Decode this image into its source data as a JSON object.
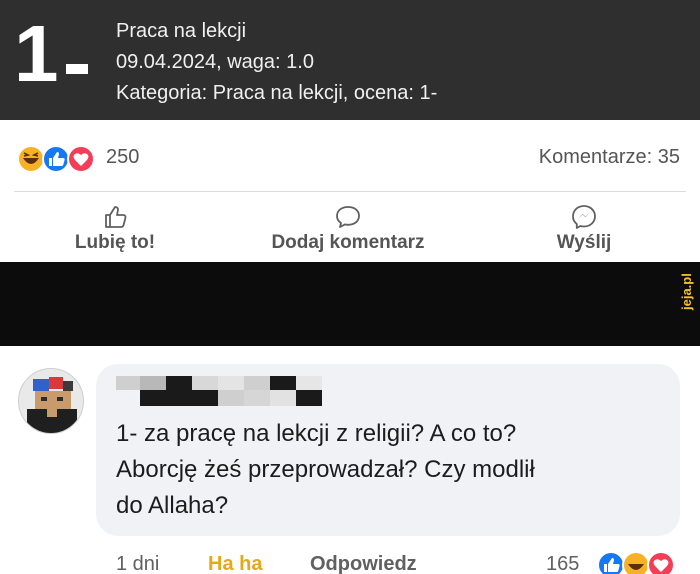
{
  "grade": {
    "value": "1",
    "lines": [
      "Praca na lekcji",
      "09.04.2024, waga: 1.0",
      "Kategoria: Praca na lekcji, ocena: 1-"
    ]
  },
  "stats": {
    "reactions_count": "250",
    "comments_label": "Komentarze: 35",
    "reaction_icons": [
      "haha-icon",
      "like-icon",
      "love-icon"
    ]
  },
  "actions": {
    "like": "Lubię to!",
    "comment": "Dodaj komentarz",
    "send": "Wyślij"
  },
  "watermark": "jeja.pl",
  "comment": {
    "text": "1- za pracę na lekcji z religii? A co to? Aborcję żeś przeprowadzał? Czy modlił do Allaha?",
    "lines": [
      "1- za pracę na lekcji z religii? A co to?",
      "Aborcję żeś przeprowadzał? Czy modlił",
      "do Allaha?"
    ],
    "time": "1 dni",
    "reaction_label": "Ha ha",
    "reply": "Odpowiedz",
    "reactions_count": "165",
    "reaction_icons": [
      "like-icon",
      "haha-icon",
      "love-icon"
    ]
  },
  "colors": {
    "header_bg": "#2f2f2f",
    "like_blue": "#1877f2",
    "love_red": "#f33e58",
    "haha_yellow": "#f7b125",
    "watermark_yellow": "#f2c230"
  }
}
